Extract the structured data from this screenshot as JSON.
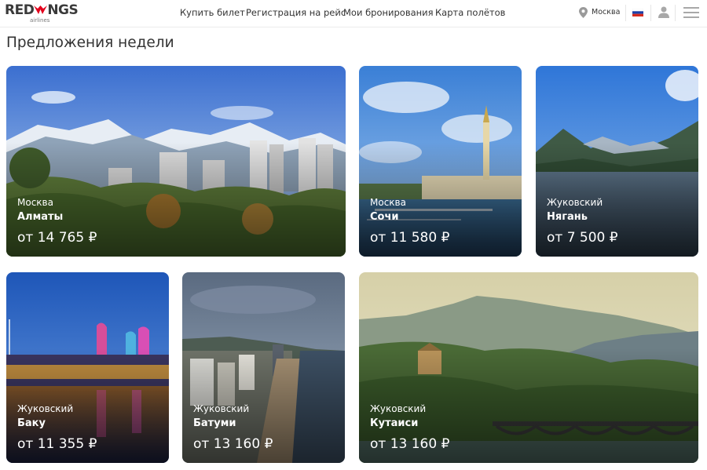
{
  "header": {
    "logo_text_left": "RED",
    "logo_text_right": "NGS",
    "logo_sub": "airlines",
    "nav": [
      {
        "label": "Купить билет"
      },
      {
        "label": "Регистрация на рейс"
      },
      {
        "label": "Мои бронирования"
      },
      {
        "label": "Карта полётов"
      }
    ],
    "city": "Москва",
    "icons": [
      "location-pin-icon",
      "russia-flag-icon",
      "user-icon",
      "menu-icon"
    ]
  },
  "section": {
    "title": "Предложения недели"
  },
  "offers": [
    {
      "from": "Москва",
      "to": "Алматы",
      "price": "от 14 765 ₽"
    },
    {
      "from": "Москва",
      "to": "Сочи",
      "price": "от 11 580 ₽"
    },
    {
      "from": "Жуковский",
      "to": "Нягань",
      "price": "от 7 500 ₽"
    },
    {
      "from": "Жуковский",
      "to": "Баку",
      "price": "от 11 355 ₽"
    },
    {
      "from": "Жуковский",
      "to": "Батуми",
      "price": "от 13 160 ₽"
    },
    {
      "from": "Жуковский",
      "to": "Кутаиси",
      "price": "от 13 160 ₽"
    }
  ],
  "colors": {
    "brand_red": "#e3001b",
    "text": "#333333"
  }
}
